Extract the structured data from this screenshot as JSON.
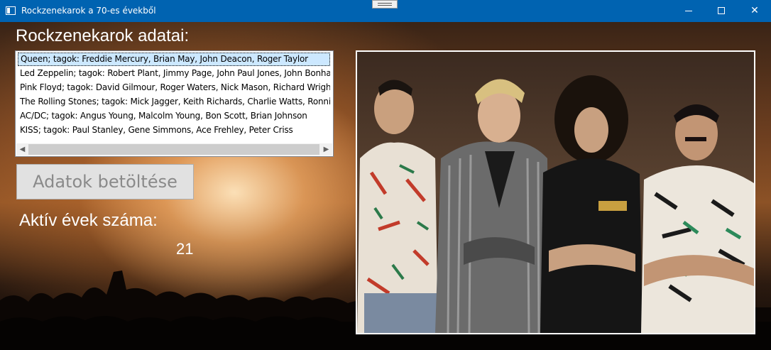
{
  "window": {
    "title": "Rockzenekarok a 70-es évekből",
    "controls": [
      "minimize-icon",
      "maximize-icon",
      "close-icon"
    ]
  },
  "main": {
    "heading": "Rockzenekarok adatai:",
    "list": {
      "items": [
        "Queen; tagok: Freddie Mercury, Brian May, John Deacon, Roger Taylor",
        "Led Zeppelin; tagok: Robert Plant, Jimmy Page, John Paul Jones, John Bonham",
        "Pink Floyd; tagok: David Gilmour, Roger Waters, Nick Mason, Richard Wright",
        "The Rolling Stones; tagok: Mick Jagger, Keith Richards, Charlie Watts, Ronnie Wood",
        "AC/DC; tagok: Angus Young, Malcolm Young, Bon Scott, Brian Johnson",
        "KISS; tagok: Paul Stanley, Gene Simmons, Ace Frehley, Peter Criss"
      ],
      "selected_index": 0
    },
    "load_button": "Adatok betöltése",
    "years_label": "Aktív évek száma:",
    "years_value": "21"
  },
  "colors": {
    "titlebar": "#0063b1",
    "selection": "#cce8ff",
    "button_bg": "#e1e1e1",
    "button_text": "#8a8a8a"
  }
}
